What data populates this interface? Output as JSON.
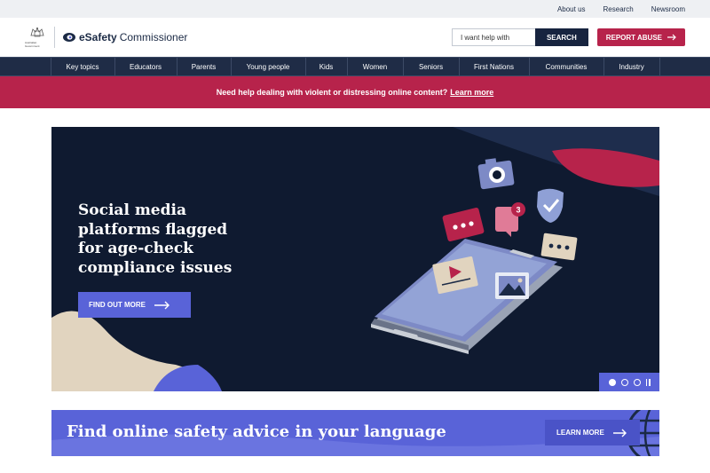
{
  "topbar": {
    "links": [
      "About us",
      "Research",
      "Newsroom"
    ]
  },
  "header": {
    "brand_e": "eSafety",
    "brand_rest": "Commissioner",
    "crest_label": "Australian Government",
    "search": {
      "placeholder": "I want help with",
      "button_label": "SEARCH"
    },
    "report_label": "REPORT ABUSE"
  },
  "nav": {
    "items": [
      "Key topics",
      "Educators",
      "Parents",
      "Young people",
      "Kids",
      "Women",
      "Seniors",
      "First Nations",
      "Communities",
      "Industry"
    ]
  },
  "alert": {
    "text": "Need help dealing with violent or distressing online content?",
    "link": "Learn more"
  },
  "hero": {
    "title": "Social media platforms flagged for age-check compliance issues",
    "button_label": "FIND OUT MORE",
    "notification_count": "3",
    "slides": 3,
    "active_slide": 1
  },
  "language_banner": {
    "title": "Find online safety advice in your language",
    "button_label": "LEARN MORE"
  },
  "colors": {
    "navy": "#1f2c46",
    "crimson": "#b7234b",
    "indigo": "#5963d8",
    "hero_bg": "#0f1a30"
  }
}
